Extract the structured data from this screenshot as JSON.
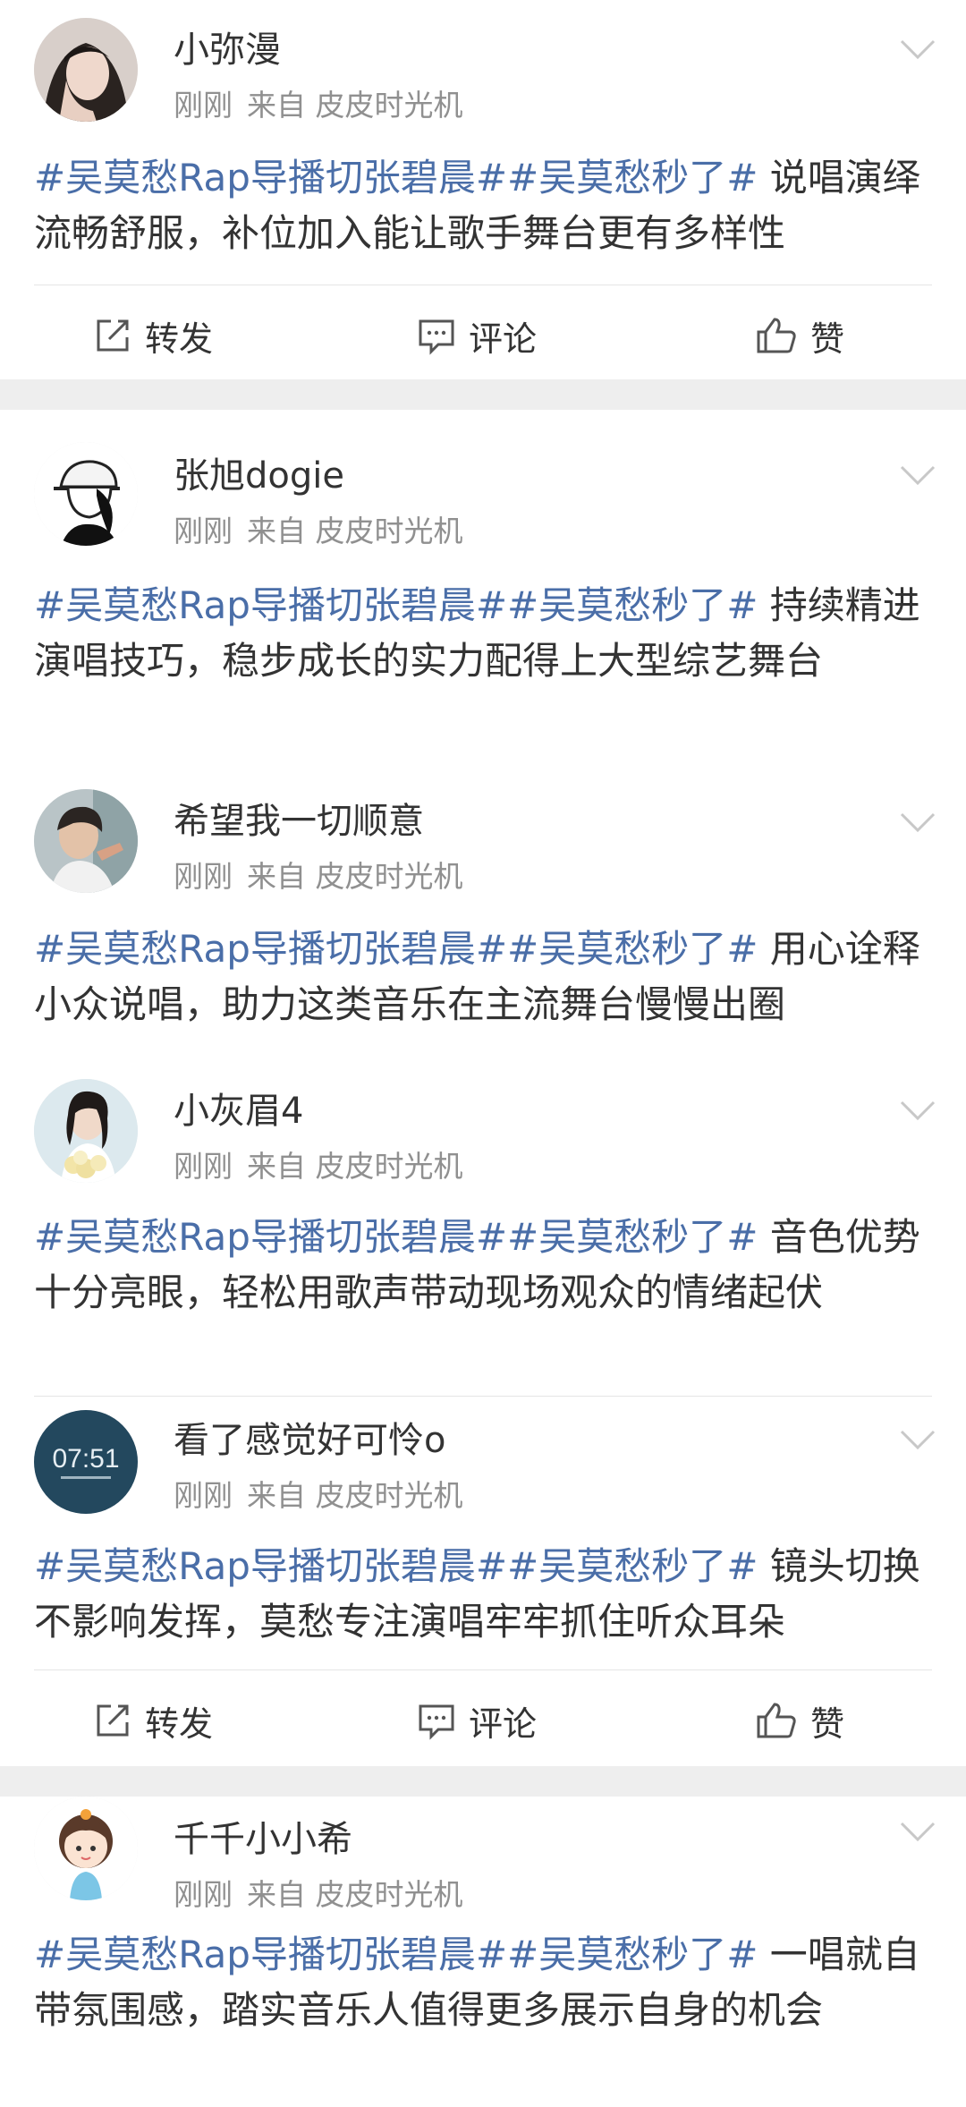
{
  "posts": [
    {
      "name": "小弥漫",
      "time": "刚刚",
      "source": "来自 皮皮时光机",
      "topic1": "#吴莫愁Rap导播切张碧晨#",
      "topic2": "#吴莫愁秒了#",
      "body": " 说唱演绎流畅舒服，补位加入能让歌手舞台更有多样性",
      "avatar": "girl-hand-face-avatar"
    },
    {
      "name": "张旭dogie",
      "time": "刚刚",
      "source": "来自 皮皮时光机",
      "topic1": "#吴莫愁Rap导播切张碧晨#",
      "topic2": "#吴莫愁秒了#",
      "body": " 持续精进演唱技巧，稳步成长的实力配得上大型综艺舞台",
      "avatar": "cartoon-boy-cap-avatar"
    },
    {
      "name": "希望我一切顺意",
      "time": "刚刚",
      "source": "来自 皮皮时光机",
      "topic1": "#吴莫愁Rap导播切张碧晨#",
      "topic2": "#吴莫愁秒了#",
      "body": " 用心诠释小众说唱，助力这类音乐在主流舞台慢慢出圈",
      "avatar": "boy-photo-avatar"
    },
    {
      "name": "小灰眉4",
      "time": "刚刚",
      "source": "来自 皮皮时光机",
      "topic1": "#吴莫愁Rap导播切张碧晨#",
      "topic2": "#吴莫愁秒了#",
      "body": " 音色优势十分亮眼，轻松用歌声带动现场观众的情绪起伏",
      "avatar": "girl-flowers-avatar"
    },
    {
      "name": "看了感觉好可怜o",
      "time": "刚刚",
      "source": "来自 皮皮时光机",
      "topic1": "#吴莫愁Rap导播切张碧晨#",
      "topic2": "#吴莫愁秒了#",
      "body": " 镜头切换不影响发挥，莫愁专注演唱牢牢抓住听众耳朵",
      "avatar": "clock-avatar",
      "avatar_text": "07:51"
    },
    {
      "name": "千千小小希",
      "time": "刚刚",
      "source": "来自 皮皮时光机",
      "topic1": "#吴莫愁Rap导播切张碧晨#",
      "topic2": "#吴莫愁秒了#",
      "body": " 一唱就自带氛围感，踏实音乐人值得更多展示自身的机会",
      "avatar": "cartoon-girl-avatar"
    }
  ],
  "actions": {
    "repost": "转发",
    "comment": "评论",
    "like": "赞"
  },
  "colors": {
    "topic": "#4a6ea8",
    "meta": "#909090",
    "text": "#333333",
    "separator": "#eeeeee"
  }
}
